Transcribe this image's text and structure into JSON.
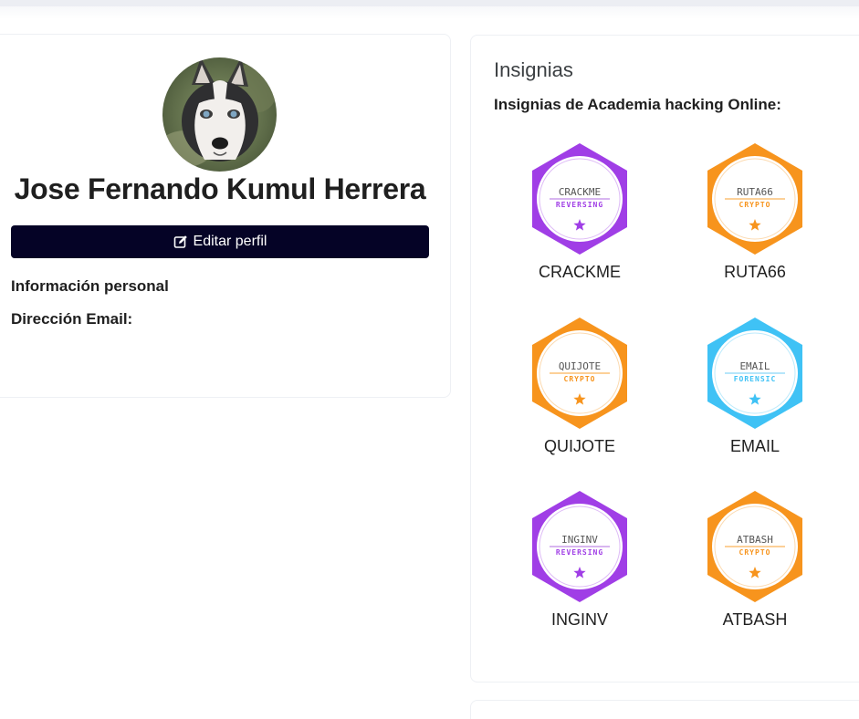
{
  "profile": {
    "name": "Jose Fernando Kumul Herrera",
    "edit_button_label": "Editar perfil",
    "personal_info_label": "Información personal",
    "email_label": "Dirección Email:"
  },
  "badges_section": {
    "title": "Insignias",
    "subtitle": "Insignias de Academia hacking Online:",
    "badges": [
      {
        "label": "CRACKME",
        "badge_text": "CRACKME",
        "category": "REVERSING",
        "color": "#a03ee6",
        "inner_line": "#c08ae8",
        "icon": "star-icon"
      },
      {
        "label": "RUTA66",
        "badge_text": "RUTA66",
        "category": "CRYPTO",
        "color": "#f7941d",
        "inner_line": "#f9b45a",
        "icon": "star-icon"
      },
      {
        "label": "QUIJOTE",
        "badge_text": "QUIJOTE",
        "category": "CRYPTO",
        "color": "#f7941d",
        "inner_line": "#f9b45a",
        "icon": "star-icon"
      },
      {
        "label": "EMAIL",
        "badge_text": "EMAIL",
        "category": "FORENSIC",
        "color": "#3fc2f5",
        "inner_line": "#8ad7f7",
        "icon": "star-icon"
      },
      {
        "label": "INGINV",
        "badge_text": "INGINV",
        "category": "REVERSING",
        "color": "#a03ee6",
        "inner_line": "#c08ae8",
        "icon": "star-icon"
      },
      {
        "label": "ATBASH",
        "badge_text": "ATBASH",
        "category": "CRYPTO",
        "color": "#f7941d",
        "inner_line": "#f9b45a",
        "icon": "star-icon"
      }
    ]
  },
  "colors": {
    "primary_button": "#050326",
    "topbar": "#eceef3"
  }
}
